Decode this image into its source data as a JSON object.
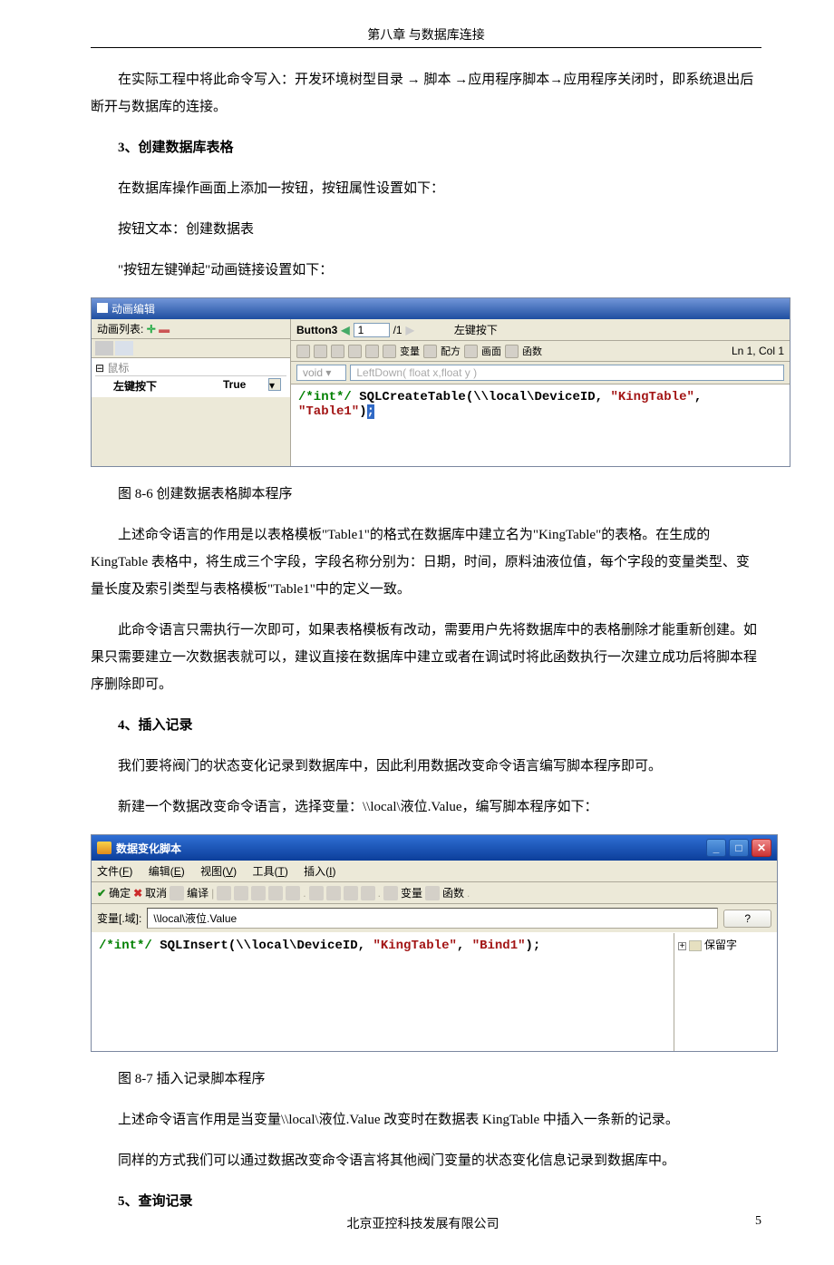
{
  "header": {
    "title": "第八章 与数据库连接"
  },
  "p1": "在实际工程中将此命令写入：开发环境树型目录 → 脚本 →应用程序脚本→应用程序关闭时，即系统退出后断开与数据库的连接。",
  "h1": "3、创建数据库表格",
  "p2": "在数据库操作画面上添加一按钮，按钮属性设置如下：",
  "p3": "按钮文本：创建数据表",
  "p4": "\"按钮左键弹起\"动画链接设置如下：",
  "sc1": {
    "title": "动画编辑",
    "listLabel": "动画列表:",
    "treeHeader": "鼠标",
    "treeItem": "左键按下",
    "treeValue": "True",
    "btn": "Button3",
    "spinVal": "1",
    "spinTotal": "/1",
    "spinSuffix": "左键按下",
    "status": "Ln 1, Col 1",
    "tbVar": "变量",
    "tbPf": "配方",
    "tbHm": "画面",
    "tbFn": "函数",
    "voidSel": "void",
    "proto": "LeftDown( float x,float y )",
    "code_c": "/*int*/",
    "code_t1": " SQLCreateTable(\\\\local\\DeviceID, ",
    "code_s1": "\"KingTable\"",
    "code_t2": ", ",
    "code_s2": "\"Table1\"",
    "code_t3": ")",
    "cursor": ";"
  },
  "cap1": "图 8-6 创建数据表格脚本程序",
  "p5": "上述命令语言的作用是以表格模板\"Table1\"的格式在数据库中建立名为\"KingTable\"的表格。在生成的 KingTable 表格中，将生成三个字段，字段名称分别为：日期，时间，原料油液位值，每个字段的变量类型、变量长度及索引类型与表格模板\"Table1\"中的定义一致。",
  "p6": "此命令语言只需执行一次即可，如果表格模板有改动，需要用户先将数据库中的表格删除才能重新创建。如果只需要建立一次数据表就可以，建议直接在数据库中建立或者在调试时将此函数执行一次建立成功后将脚本程序删除即可。",
  "h2": "4、插入记录",
  "p7": "我们要将阀门的状态变化记录到数据库中，因此利用数据改变命令语言编写脚本程序即可。",
  "p8": "新建一个数据改变命令语言，选择变量：\\\\local\\液位.Value，编写脚本程序如下：",
  "sc2": {
    "title": "数据变化脚本",
    "menu": {
      "file": "文件",
      "edit": "编辑",
      "view": "视图",
      "tool": "工具",
      "insert": "插入",
      "fA": "F",
      "eA": "E",
      "vA": "V",
      "tA": "T",
      "iA": "I"
    },
    "confirm": "确定",
    "cancel": "取消",
    "compile": "编译",
    "tbVar": "变量",
    "tbFn": "函数",
    "varLabel": "变量[.域]:",
    "varValue": "\\\\local\\液位.Value",
    "qmark": "?",
    "code_c": "/*int*/",
    "code_t1": " SQLInsert(\\\\local\\DeviceID, ",
    "code_s1": "\"KingTable\"",
    "code_t2": ", ",
    "code_s2": "\"Bind1\"",
    "code_t3": ");",
    "sidepane": "保留字"
  },
  "cap2": "图 8-7 插入记录脚本程序",
  "p9": "上述命令语言作用是当变量\\\\local\\液位.Value 改变时在数据表 KingTable 中插入一条新的记录。",
  "p10": "同样的方式我们可以通过数据改变命令语言将其他阀门变量的状态变化信息记录到数据库中。",
  "h3": "5、查询记录",
  "footer": {
    "company": "北京亚控科技发展有限公司",
    "page": "5"
  }
}
